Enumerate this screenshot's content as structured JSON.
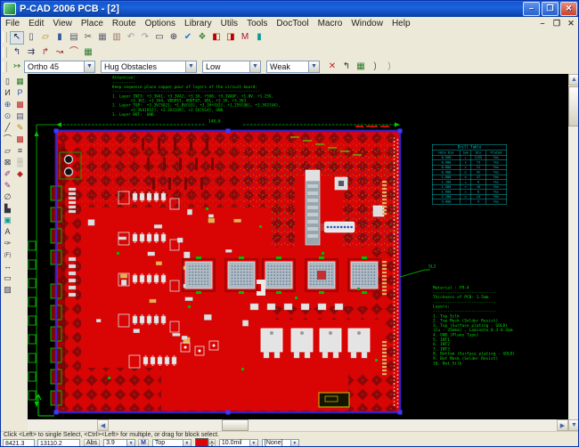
{
  "window": {
    "title": "P-CAD 2006 PCB - [2]"
  },
  "menu": {
    "items": [
      "File",
      "Edit",
      "View",
      "Place",
      "Route",
      "Options",
      "Library",
      "Utils",
      "Tools",
      "DocTool",
      "Macro",
      "Window",
      "Help"
    ]
  },
  "toolbars": {
    "main": [
      {
        "name": "select-tool-icon",
        "glyph": "↖",
        "color": "#111",
        "pressed": true
      },
      {
        "name": "new-file-icon",
        "glyph": "▯",
        "color": "#446"
      },
      {
        "name": "open-folder-icon",
        "glyph": "▱",
        "color": "#b8860b"
      },
      {
        "name": "save-icon",
        "glyph": "▮",
        "color": "#33589e"
      },
      {
        "name": "print-icon",
        "glyph": "▤",
        "color": "#556"
      },
      {
        "name": "cut-icon",
        "glyph": "✂",
        "color": "#555"
      },
      {
        "name": "copy-icon",
        "glyph": "▦",
        "color": "#667"
      },
      {
        "name": "paste-icon",
        "glyph": "▥",
        "color": "#976"
      },
      {
        "name": "undo-icon",
        "glyph": "↶",
        "color": "#99a"
      },
      {
        "name": "redo-icon",
        "glyph": "↷",
        "color": "#99a"
      },
      {
        "name": "viewport-icon",
        "glyph": "▭",
        "color": "#334"
      },
      {
        "name": "zoom-icon",
        "glyph": "⊕",
        "color": "#334"
      },
      {
        "name": "drc-check-icon",
        "glyph": "✔",
        "color": "#1a7ad4"
      },
      {
        "name": "renumber-icon",
        "glyph": "❖",
        "color": "#3a8a3a"
      },
      {
        "name": "record-red-icon",
        "glyph": "◧",
        "color": "#b00"
      },
      {
        "name": "record-red2-icon",
        "glyph": "◨",
        "color": "#b00"
      },
      {
        "name": "macro-m-icon",
        "glyph": "M",
        "color": "#b01030"
      },
      {
        "name": "cyan-tool-icon",
        "glyph": "▮",
        "color": "#0a9a9a"
      }
    ],
    "route": [
      {
        "name": "route-manual-icon",
        "glyph": "↰",
        "color": "#336"
      },
      {
        "name": "route-interactive-icon",
        "glyph": "⇉",
        "color": "#336"
      },
      {
        "name": "route-miter-icon",
        "glyph": "↱",
        "color": "#933"
      },
      {
        "name": "route-bus-icon",
        "glyph": "↝",
        "color": "#933"
      },
      {
        "name": "route-arc-icon",
        "glyph": "⌒",
        "color": "#b22"
      },
      {
        "name": "autorouter-icon",
        "glyph": "▦",
        "color": "#2a7a2a"
      }
    ],
    "options": {
      "lead_icon": {
        "name": "route-start-icon",
        "glyph": "↣",
        "color": "#2a7a2a"
      },
      "combos": [
        {
          "name": "route-mode-select",
          "value": "Ortho 45",
          "w": 80
        },
        {
          "name": "obstacle-mode-select",
          "value": "Hug Obstacles",
          "w": 108
        },
        {
          "name": "priority-select",
          "value": "Low",
          "w": 66
        },
        {
          "name": "strength-select",
          "value": "Weak",
          "w": 60
        }
      ],
      "tail_icons": [
        {
          "name": "cancel-route-icon",
          "glyph": "✕",
          "color": "#c22"
        },
        {
          "name": "unwind-icon",
          "glyph": "↰",
          "color": "#333"
        },
        {
          "name": "board-view-icon",
          "glyph": "▦",
          "color": "#2a7a2a"
        },
        {
          "name": "arc-left-icon",
          "glyph": ")",
          "color": "#555"
        },
        {
          "name": "arc-right-icon",
          "glyph": ")",
          "color": "#999"
        }
      ]
    }
  },
  "palette": {
    "col1": [
      {
        "name": "record-icon",
        "glyph": "▯",
        "color": "#334"
      },
      {
        "name": "part-icon",
        "glyph": "И",
        "color": "#334"
      },
      {
        "name": "zoom-in-icon",
        "glyph": "⊕",
        "color": "#33589e"
      },
      {
        "name": "zoom-center-icon",
        "glyph": "⊙",
        "color": "#33589e"
      },
      {
        "name": "line-icon",
        "glyph": "╱",
        "color": "#334"
      },
      {
        "name": "arc-icon",
        "glyph": "⌒",
        "color": "#334"
      },
      {
        "name": "polygon-icon",
        "glyph": "▱",
        "color": "#334"
      },
      {
        "name": "cutout-icon",
        "glyph": "⊠",
        "color": "#334"
      },
      {
        "name": "copper-pour-icon",
        "glyph": "✐",
        "color": "#8a2a8a"
      },
      {
        "name": "plane-icon",
        "glyph": "✎",
        "color": "#8a2a8a"
      },
      {
        "name": "keepout-icon",
        "glyph": "∅",
        "color": "#334"
      },
      {
        "name": "room-icon",
        "glyph": "▙",
        "color": "#334"
      },
      {
        "name": "via-icon",
        "glyph": "▣",
        "color": "#0a9a9a"
      },
      {
        "name": "text-icon",
        "glyph": "A",
        "color": "#334"
      },
      {
        "name": "pick-point-icon",
        "glyph": "✑",
        "color": "#334"
      },
      {
        "name": "field-icon",
        "glyph": "(F)",
        "color": "#334"
      },
      {
        "name": "dimension-icon",
        "glyph": "↔",
        "color": "#334"
      },
      {
        "name": "rect-icon",
        "glyph": "▭",
        "color": "#334"
      },
      {
        "name": "hatch-icon",
        "glyph": "▨",
        "color": "#335"
      }
    ],
    "col2": [
      {
        "name": "design-manager-icon",
        "glyph": "▦",
        "color": "#2a7a2a"
      },
      {
        "name": "part-browser-icon",
        "glyph": "P",
        "color": "#33589e"
      },
      {
        "name": "error-marker-icon",
        "glyph": "▩",
        "color": "#b22"
      },
      {
        "name": "display-options-icon",
        "glyph": "▤",
        "color": "#557"
      },
      {
        "name": "edit-styles-icon",
        "glyph": "✎",
        "color": "#b8860b"
      },
      {
        "name": "net-highlight-icon",
        "glyph": "▩",
        "color": "#b22"
      },
      {
        "name": "list-icon",
        "glyph": "≡",
        "color": "#334"
      },
      {
        "name": "shade-icon",
        "glyph": "▒",
        "color": "#888"
      },
      {
        "name": "marker-icon",
        "glyph": "◆",
        "color": "#b22"
      }
    ]
  },
  "canvas": {
    "attention_lines": [
      "Attention!",
      "----------",
      "Keep sequence place copper pour of layers of the circuit board:",
      "----------------------------------------------------------------",
      "1. Layer INT3: +3.3VA1, +3.3VA2, +3.3V, +5V0, +3.3VADF, +1.8V, +1.25V,",
      "        +3.3V2, +3.3V4, VDDPST, VDDTXT, VDL, +3.3V, +3.3V3",
      "2. Layer TOP:  +3.3V[SO2], +1.8V[U3], +3.3V+[U2], +1.25V[U6], +3.3V2[U4],",
      "        +3.3V4[U12], +3.3V3[U9], +2.5V[U14], GND",
      "3. Layer BOT:  GND"
    ],
    "top_dimension_label": "148.0",
    "stackup_pointer_label": "SL3",
    "stackup_lines": [
      "Material : FR-4",
      "--------------------------",
      "Thickness of PCB: 1.5mm",
      "--------------------------",
      "Layers:",
      "--------------------------",
      "1. Top Silk",
      "2. Top Mask (Solder Resist)",
      "3. Top (Surface plating - GOLD)",
      "(Cu - 35mkm) , Laminate 0.3-0.4mm",
      "4. GND (Plane Type)",
      "5. INT1",
      "6. INT2",
      "7. INT3",
      "8. Bottom (Surface plating - GOLD)",
      "9. Bot Mask (Solder Resist)",
      "10. Bot Silk"
    ],
    "drill_table": {
      "title": "Drill Table",
      "headers": [
        "Hole Dia",
        "Sym",
        "Qty",
        "Plated"
      ],
      "rows": [
        [
          "0.500",
          "+",
          "1255",
          "Yes"
        ],
        [
          "0.600",
          "x",
          "73",
          "Yes"
        ],
        [
          "0.800",
          "◇",
          "31",
          "Yes"
        ],
        [
          "0.900",
          "□",
          "92",
          "Yes"
        ],
        [
          "1.000",
          "⊙",
          "47",
          "Yes"
        ],
        [
          "1.100",
          "△",
          "8",
          "Yes"
        ],
        [
          "1.500",
          "▽",
          "16",
          "Yes"
        ],
        [
          "1.600",
          "○",
          "8",
          "Yes"
        ],
        [
          "2.200",
          "◎",
          "24",
          "Yes"
        ],
        [
          "3.000",
          "☆",
          "4",
          "Yes"
        ]
      ]
    }
  },
  "statusbar": {
    "prompt": "Click <Left> to single Select, <Ctrl><Left> for multiple, or drag for block select.",
    "x_coord": "8421.3",
    "y_coord": "13110.2",
    "abs_label": "Abs",
    "grid_value": "3.9",
    "macro_label": "M",
    "layer_value": "Top",
    "line_width_value": "10.0mil",
    "net_value": "[None]",
    "layer_color": "#e00505"
  },
  "colors": {
    "board_red": "#d90404",
    "diamond_dark": "#8c0808",
    "annotation_green": "#00d800",
    "table_cyan": "#00c8c8"
  }
}
